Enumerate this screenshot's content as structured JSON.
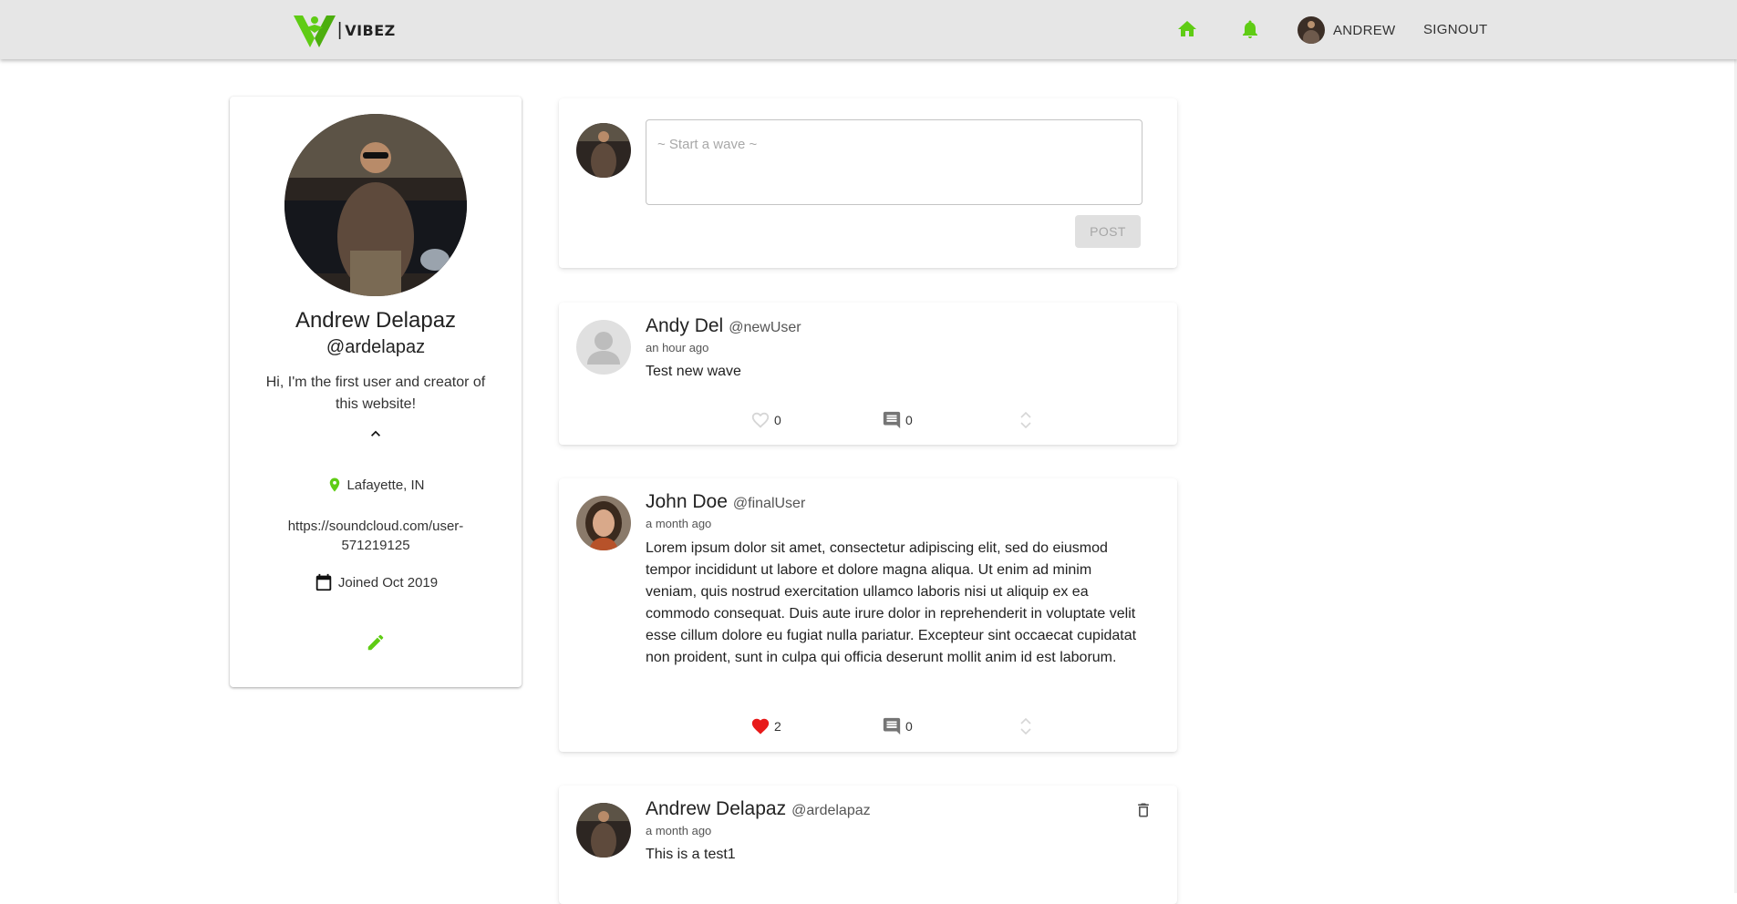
{
  "app": {
    "brand": "VIBEZ",
    "brand_color": "#5fcc14"
  },
  "nav": {
    "home_icon": "home-icon",
    "notifications_icon": "bell-icon",
    "user_label": "ANDREW",
    "signout_label": "SIGNOUT"
  },
  "profile": {
    "full_name": "Andrew Delapaz",
    "handle": "@ardelapaz",
    "bio": "Hi, I'm the first user and creator of this website!",
    "location": "Lafayette, IN",
    "website": "https://soundcloud.com/user-571219125",
    "joined": "Joined Oct 2019"
  },
  "composer": {
    "placeholder": "~ Start a wave ~",
    "post_label": "POST"
  },
  "posts": [
    {
      "name": "Andy Del",
      "handle": "@newUser",
      "time": "an hour ago",
      "body": "Test new wave",
      "likes": "0",
      "comments": "0",
      "liked": false
    },
    {
      "name": "John Doe",
      "handle": "@finalUser",
      "time": "a month ago",
      "body": "Lorem ipsum dolor sit amet, consectetur adipiscing elit, sed do eiusmod tempor incididunt ut labore et dolore magna aliqua. Ut enim ad minim veniam, quis nostrud exercitation ullamco laboris nisi ut aliquip ex ea commodo consequat. Duis aute irure dolor in reprehenderit in voluptate velit esse cillum dolore eu fugiat nulla pariatur. Excepteur sint occaecat cupidatat non proident, sunt in culpa qui officia deserunt mollit anim id est laborum.",
      "likes": "2",
      "comments": "0",
      "liked": true
    },
    {
      "name": "Andrew Delapaz",
      "handle": "@ardelapaz",
      "time": "a month ago",
      "body": "This is a test1"
    }
  ]
}
